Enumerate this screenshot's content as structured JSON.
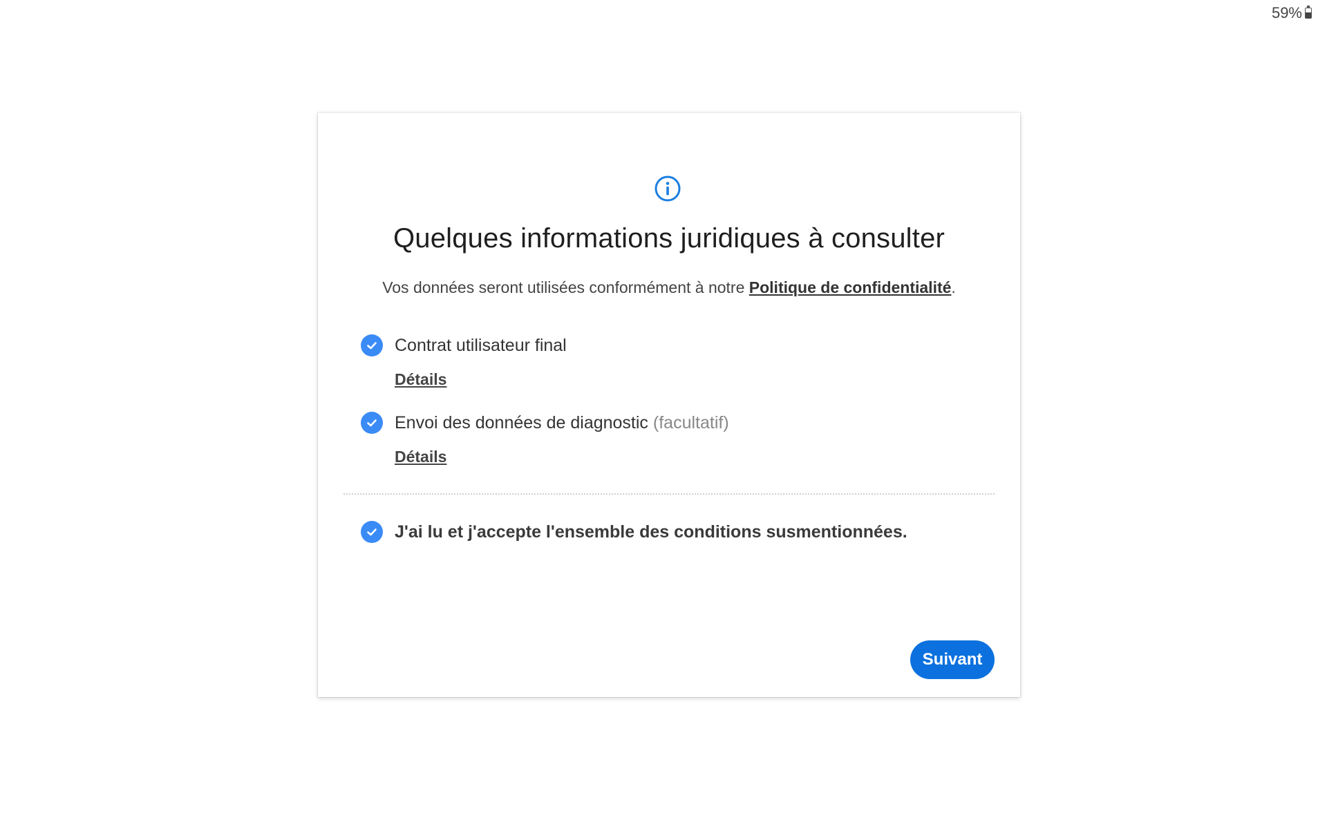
{
  "status_bar": {
    "battery_text": "59%",
    "battery_level": 0.59,
    "icon": "battery-icon"
  },
  "dialog": {
    "header_icon": "info-icon",
    "title": "Quelques informations juridiques à consulter",
    "subtitle_prefix": "Vos données seront utilisées conformément à notre ",
    "privacy_link": "Politique de confidentialité",
    "subtitle_suffix": ".",
    "items": [
      {
        "label": "Contrat utilisateur final",
        "optional": "",
        "checked": true,
        "details_label": "Détails"
      },
      {
        "label": "Envoi des données de diagnostic ",
        "optional": "(facultatif)",
        "checked": true,
        "details_label": "Détails"
      }
    ],
    "accept_all": {
      "label": "J'ai lu et j'accepte l'ensemble des conditions susmentionnées.",
      "checked": true
    },
    "next_button": "Suivant"
  },
  "colors": {
    "accent": "#0c71de",
    "check": "#3a8bf5",
    "info_icon": "#1a7fe0"
  }
}
